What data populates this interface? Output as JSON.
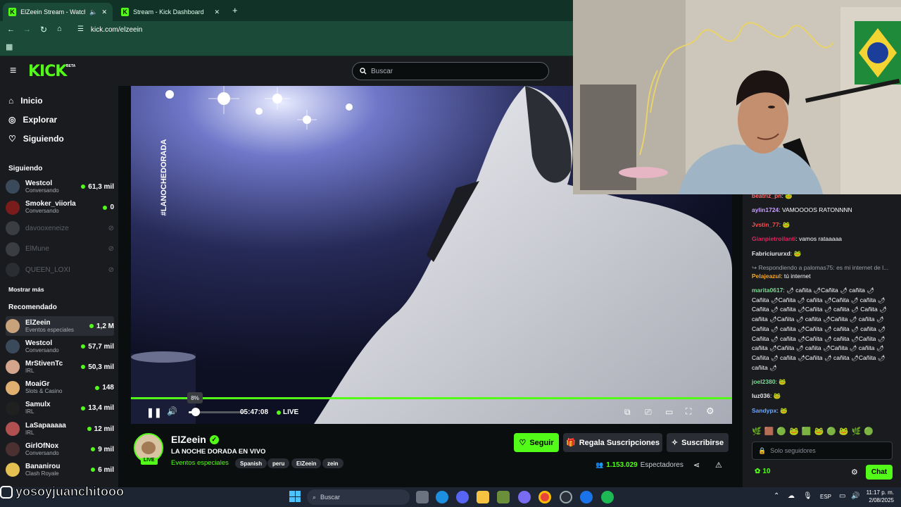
{
  "browser": {
    "tabs": [
      {
        "title": "ElZeein Stream - Watch Live",
        "active": true
      },
      {
        "title": "Stream - Kick Dashboard",
        "active": false
      }
    ],
    "url": "kick.com/elzeein"
  },
  "header": {
    "logo": "KICK",
    "logo_badge": "BETA",
    "search_placeholder": "Buscar"
  },
  "nav": [
    {
      "label": "Inicio",
      "icon": "home-icon"
    },
    {
      "label": "Explorar",
      "icon": "compass-icon"
    },
    {
      "label": "Siguiendo",
      "icon": "heart-icon"
    }
  ],
  "following": {
    "title": "Siguiendo",
    "channels": [
      {
        "name": "Westcol",
        "category": "Conversando",
        "viewers": "61,3 mil",
        "live": true,
        "color": "#3a4a5a"
      },
      {
        "name": "Smoker_viiorla",
        "category": "Conversando",
        "viewers": "0",
        "live": true,
        "color": "#7a1c1c"
      },
      {
        "name": "davooxeneize",
        "category": "",
        "viewers": "",
        "live": false,
        "color": "#3a3d42"
      },
      {
        "name": "ElMune",
        "category": "",
        "viewers": "",
        "live": false,
        "color": "#3a3d42"
      },
      {
        "name": "QUEEN_LOXI",
        "category": "",
        "viewers": "",
        "live": false,
        "color": "#2a2d31"
      }
    ],
    "show_more": "Mostrar más"
  },
  "recommended": {
    "title": "Recomendado",
    "channels": [
      {
        "name": "ElZeein",
        "category": "Eventos especiales",
        "viewers": "1,2 M",
        "color": "#c8a27a",
        "active": true
      },
      {
        "name": "Westcol",
        "category": "Conversando",
        "viewers": "57,7 mil",
        "color": "#3a4a5a"
      },
      {
        "name": "MrStivenTc",
        "category": "IRL",
        "viewers": "50,3 mil",
        "color": "#d4a58c"
      },
      {
        "name": "MoaiGr",
        "category": "Slots & Casino",
        "viewers": "148",
        "color": "#e0b070"
      },
      {
        "name": "Samulx",
        "category": "IRL",
        "viewers": "13,4 mil",
        "color": "#202020"
      },
      {
        "name": "LaSapaaaaa",
        "category": "IRL",
        "viewers": "12 mil",
        "color": "#b05050"
      },
      {
        "name": "GirlOfNox",
        "category": "Conversando",
        "viewers": "9 mil",
        "color": "#4a3030"
      },
      {
        "name": "Bananirou",
        "category": "Clash Royale",
        "viewers": "6 mil",
        "color": "#e4c050"
      }
    ]
  },
  "player": {
    "overlay_text": "#LANOCHEDORADA",
    "volume_tooltip": "8%",
    "volume": 0.08,
    "time": "05:47:08",
    "live_label": "LIVE"
  },
  "stream": {
    "streamer": "ElZeein",
    "title": "LA NOCHE DORADA EN VIVO",
    "category": "Eventos especiales",
    "tags": [
      "Spanish",
      "peru",
      "ElZeein",
      "zein"
    ],
    "live_badge": "LIVE",
    "follow_label": "Seguir",
    "gift_label": "Regala Suscripciones",
    "subscribe_label": "Suscribirse",
    "viewers": "1.153.029",
    "viewers_label": "Espectadores"
  },
  "chat": {
    "messages": [
      {
        "user": "beatriz_pn",
        "color": "#ff6b6b",
        "text": ""
      },
      {
        "user": "aylin1724",
        "color": "#c9a0ff",
        "text": "VAMOOOOS RATONNNN"
      },
      {
        "user": "Jvstin_77",
        "color": "#ff4d4d",
        "text": ""
      },
      {
        "user": "Gianpietroilanti",
        "color": "#e0245e",
        "text": "vamos rataaaaa"
      },
      {
        "user": "Fabriciururxd",
        "color": "#e6e6e6",
        "text": ""
      },
      {
        "user": "",
        "color": "#9aa0a6",
        "text": "Respondiendo a palomas75: es mi internet de l..."
      },
      {
        "user": "Pelajeazul",
        "color": "#f5a623",
        "text": "tú internet"
      },
      {
        "user": "marita0617",
        "color": "#7cd992",
        "text": "🌶 cañita 🌶Cañita 🌶 cañita 🌶 Cañita 🌶Cañita 🌶 cañita 🌶Cañita 🌶 cañita 🌶Cañita 🌶 cañita 🌶Cañita 🌶 cañita 🌶 Cañita 🌶 cañita 🌶Cañita 🌶 cañita 🌶Cañita 🌶 cañita 🌶Cañita 🌶 cañita 🌶Cañita 🌶 cañita 🌶 cañita 🌶Cañita 🌶 cañita 🌶Cañita 🌶 cañita 🌶Cañita 🌶 cañita 🌶Cañita 🌶 cañita 🌶Cañita 🌶 cañita 🌶 Cañita 🌶 cañita 🌶Cañita 🌶 cañita 🌶Cañita 🌶 cañita 🌶"
      },
      {
        "user": "joel2380",
        "color": "#7cd992",
        "text": ""
      },
      {
        "user": "luz036",
        "color": "#e6e6e6",
        "text": ""
      },
      {
        "user": "Sandypx",
        "color": "#6fa8ff",
        "text": ""
      }
    ],
    "input_placeholder": "Solo seguidores",
    "points": "10",
    "send_label": "Chat"
  },
  "overlay": {
    "instagram_handle": "yosoyjuanchitooo"
  },
  "taskbar": {
    "search_placeholder": "Buscar",
    "language": "ESP",
    "time": "11:17 p. m.",
    "date": "2/08/2025"
  },
  "colors": {
    "kick_green": "#53fc18",
    "panel": "#191b1f",
    "background": "#0b0e0f"
  }
}
